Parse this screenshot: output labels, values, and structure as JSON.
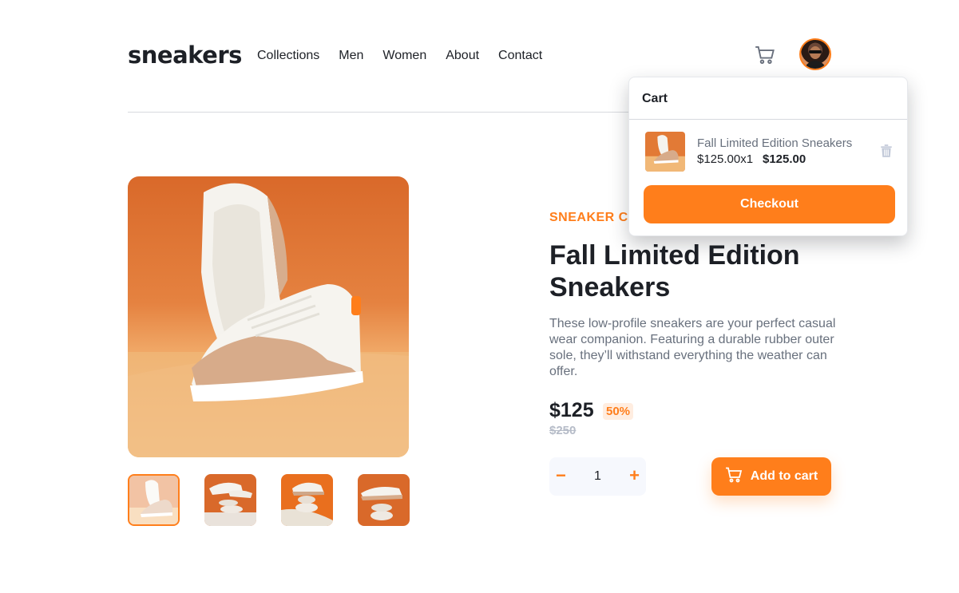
{
  "header": {
    "logo": "sneakers",
    "nav": [
      "Collections",
      "Men",
      "Women",
      "About",
      "Contact"
    ],
    "cart_icon": "cart-icon",
    "avatar_icon": "user-avatar"
  },
  "product": {
    "company": "SNEAKER CO",
    "title": "Fall Limited Edition Sneakers",
    "description": "These low-profile sneakers are your perfect casual wear companion. Featuring a durable rubber outer sole, they’ll withstand everything the weather can offer.",
    "price": "$125",
    "discount": "50%",
    "old_price": "$250",
    "quantity": "1",
    "minus_label": "−",
    "plus_label": "+",
    "add_to_cart_label": "Add to cart",
    "thumbnails": [
      "thumbnail-1",
      "thumbnail-2",
      "thumbnail-3",
      "thumbnail-4"
    ],
    "active_thumbnail": 0
  },
  "cart": {
    "title": "Cart",
    "items": [
      {
        "name": "Fall Limited Edition Sneakers",
        "unit_price": "$125.00x1",
        "total": "$125.00"
      }
    ],
    "checkout_label": "Checkout"
  },
  "colors": {
    "accent": "#ff7e1b",
    "accent_pale": "#ffede0",
    "text_dark": "#1d2026",
    "text_gray": "#68707d"
  }
}
